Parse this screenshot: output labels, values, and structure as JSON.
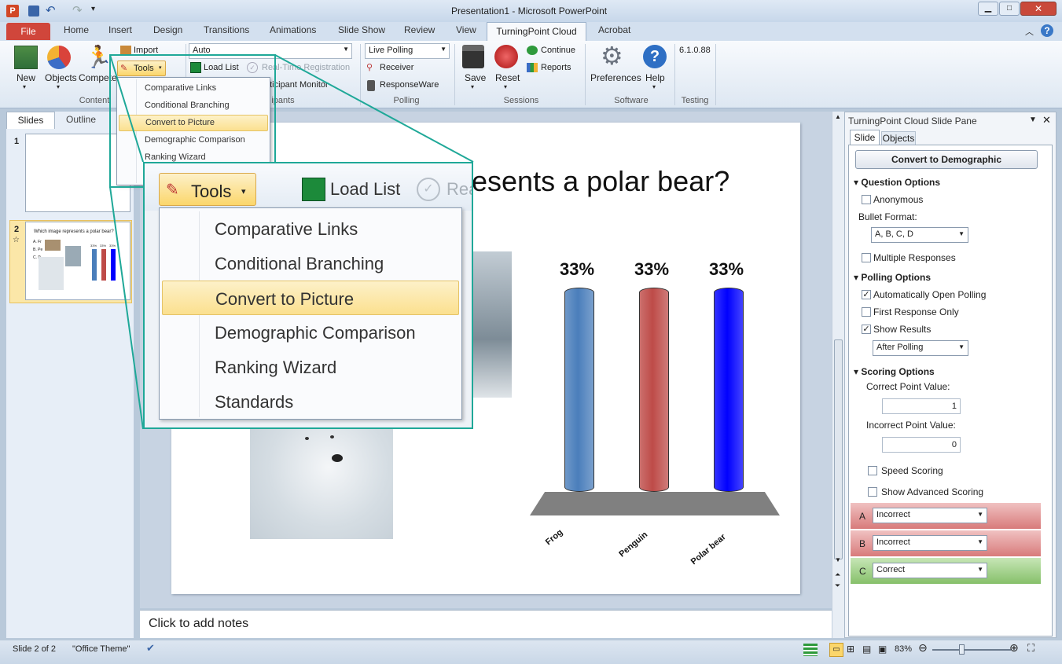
{
  "window": {
    "title": "Presentation1  -  Microsoft PowerPoint"
  },
  "ribbon_tabs": [
    "File",
    "Home",
    "Insert",
    "Design",
    "Transitions",
    "Animations",
    "Slide Show",
    "Review",
    "View",
    "TurningPoint Cloud",
    "Acrobat"
  ],
  "ribbon": {
    "content": {
      "new": "New",
      "objects": "Objects",
      "competition": "Compete",
      "import": "Import",
      "tools": "Tools",
      "label": "Content"
    },
    "participants": {
      "combo": "Auto",
      "load_list": "Load List",
      "realtime": "Real-Time Registration",
      "monitor": "Participant Monitor",
      "label": "Participants",
      "label_visible": "ipants"
    },
    "polling": {
      "combo": "Live Polling",
      "receiver": "Receiver",
      "responseware": "ResponseWare",
      "label": "Polling"
    },
    "sessions": {
      "save": "Save",
      "reset": "Reset",
      "continue": "Continue",
      "reports": "Reports",
      "label": "Sessions"
    },
    "software": {
      "preferences": "Preferences",
      "help": "Help",
      "label": "Software"
    },
    "testing": {
      "version": "6.1.0.88",
      "label": "Testing"
    }
  },
  "tools_menu": {
    "items": [
      "Comparative Links",
      "Conditional Branching",
      "Convert to Picture",
      "Demographic Comparison",
      "Ranking Wizard",
      "Standards"
    ],
    "highlighted": "Convert to Picture"
  },
  "zoom_callout": {
    "tools": "Tools",
    "load_list": "Load List",
    "realtime": "Rea"
  },
  "left_pane": {
    "tabs": [
      "Slides",
      "Outline"
    ],
    "slides": [
      "1",
      "2"
    ],
    "thumb_title": "Which image represents a polar bear?",
    "thumb_options": [
      "A. Fr",
      "B. Pe",
      "C. P"
    ],
    "thumb_pcts": [
      "33%",
      "33%",
      "33%"
    ]
  },
  "slide": {
    "title_visible": "esents a polar bear?",
    "title_full": "Which image represents a polar bear?",
    "answers": [
      "A.",
      "B.",
      "C."
    ]
  },
  "chart_data": {
    "type": "bar",
    "categories": [
      "Frog",
      "Penguin",
      "Polar bear"
    ],
    "values": [
      33,
      33,
      33
    ],
    "data_labels": [
      "33%",
      "33%",
      "33%"
    ],
    "colors": [
      "#4a7ebb",
      "#be4b48",
      "#0000ff"
    ],
    "ylim": [
      0,
      33
    ],
    "grid": false,
    "legend": "none"
  },
  "notes": {
    "placeholder": "Click to add notes"
  },
  "task_pane": {
    "title": "TurningPoint Cloud Slide Pane",
    "tabs": [
      "Slide",
      "Objects"
    ],
    "convert_button": "Convert to Demographic",
    "question_options": {
      "header": "Question Options",
      "anonymous": "Anonymous",
      "bullet_format_label": "Bullet Format:",
      "bullet_format": "A, B, C, D",
      "multiple": "Multiple Responses"
    },
    "polling_options": {
      "header": "Polling Options",
      "auto_open": "Automatically Open Polling",
      "first_response": "First Response Only",
      "show_results": "Show Results",
      "show_results_when": "After Polling"
    },
    "scoring_options": {
      "header": "Scoring Options",
      "correct_label": "Correct Point Value:",
      "correct_value": "1",
      "incorrect_label": "Incorrect Point Value:",
      "incorrect_value": "0",
      "speed": "Speed Scoring",
      "advanced": "Show Advanced Scoring"
    },
    "answers": [
      {
        "letter": "A",
        "value": "Incorrect",
        "color": "#e5a3a2"
      },
      {
        "letter": "B",
        "value": "Incorrect",
        "color": "#e5a3a2"
      },
      {
        "letter": "C",
        "value": "Correct",
        "color": "#9ccd84"
      }
    ]
  },
  "status": {
    "slide": "Slide 2 of 2",
    "theme": "\"Office Theme\"",
    "zoom": "83%"
  },
  "colors": {
    "accent_frame": "#1fa898",
    "file_tab": "#d0463b",
    "highlight": "#fbe08f"
  }
}
